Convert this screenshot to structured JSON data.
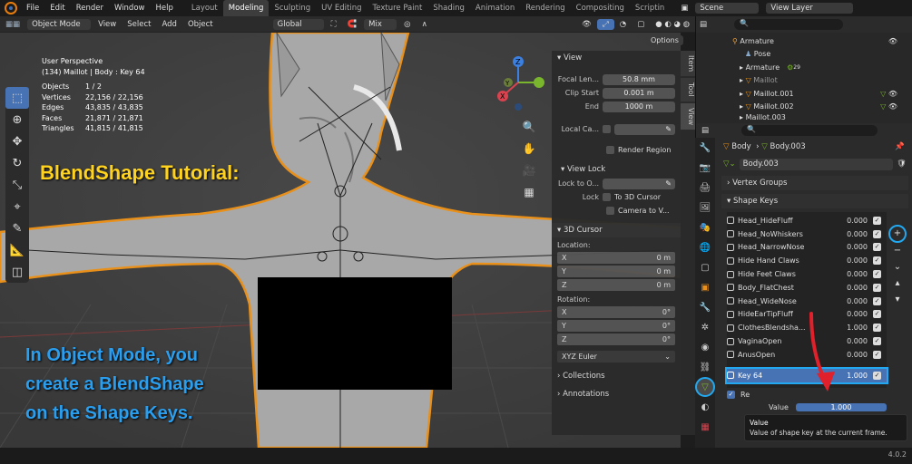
{
  "topbar": {
    "menus": [
      "File",
      "Edit",
      "Render",
      "Window",
      "Help"
    ],
    "workspaces": [
      "Layout",
      "Modeling",
      "Sculpting",
      "UV Editing",
      "Texture Paint",
      "Shading",
      "Animation",
      "Rendering",
      "Compositing",
      "Scriptin"
    ],
    "active_workspace": "Modeling",
    "scene": "Scene",
    "view_layer": "View Layer"
  },
  "viewport_header": {
    "mode": "Object Mode",
    "menus": [
      "View",
      "Select",
      "Add",
      "Object"
    ],
    "orientation": "Global",
    "mix": "Mix",
    "options": "Options"
  },
  "stats": {
    "line1": "User Perspective",
    "line2": "(134) Maillot | Body : Key 64",
    "rows": [
      {
        "k": "Objects",
        "v": "1 / 2"
      },
      {
        "k": "Vertices",
        "v": "22,156 / 22,156"
      },
      {
        "k": "Edges",
        "v": "43,835 / 43,835"
      },
      {
        "k": "Faces",
        "v": "21,871 / 21,871"
      },
      {
        "k": "Triangles",
        "v": "41,815 / 41,815"
      }
    ]
  },
  "annotations": {
    "title": "BlendShape Tutorial:",
    "text_lines": [
      "In Object Mode, you",
      "create a BlendShape",
      "on the Shape Keys."
    ]
  },
  "npanel": {
    "view_header": "View",
    "focal_label": "Focal Len...",
    "focal_value": "50.8 mm",
    "clip_start_label": "Clip Start",
    "clip_start_value": "0.001 m",
    "end_label": "End",
    "end_value": "1000 m",
    "local_camera": "Local Ca...",
    "render_region": "Render Region",
    "view_lock_header": "View Lock",
    "lock_to_label": "Lock to O...",
    "lock_label": "Lock",
    "to_3d_cursor": "To 3D Cursor",
    "camera_to_view": "Camera to V...",
    "cursor_header": "3D Cursor",
    "location_label": "Location:",
    "rotation_label": "Rotation:",
    "loc": [
      {
        "a": "X",
        "v": "0 m"
      },
      {
        "a": "Y",
        "v": "0 m"
      },
      {
        "a": "Z",
        "v": "0 m"
      }
    ],
    "rot": [
      {
        "a": "X",
        "v": "0°"
      },
      {
        "a": "Y",
        "v": "0°"
      },
      {
        "a": "Z",
        "v": "0°"
      }
    ],
    "rot_mode": "XYZ Euler",
    "collections": "Collections",
    "annotations": "Annotations",
    "tabs": [
      "Item",
      "Tool",
      "View"
    ]
  },
  "outliner": {
    "rows": [
      {
        "label": "Armature",
        "indent": 1
      },
      {
        "label": "Pose",
        "indent": 3
      },
      {
        "label": "Armature",
        "indent": 2
      },
      {
        "label": "Maillot",
        "indent": 2
      },
      {
        "label": "Maillot.001",
        "indent": 2
      },
      {
        "label": "Maillot.002",
        "indent": 2
      },
      {
        "label": "Maillot.003",
        "indent": 2
      }
    ],
    "badge": "29"
  },
  "properties": {
    "breadcrumb_a": "Body",
    "breadcrumb_b": "Body.003",
    "mesh_name": "Body.003",
    "vertex_groups": "Vertex Groups",
    "shape_keys": "Shape Keys",
    "keys": [
      {
        "name": "Head_HideFluff",
        "value": "0.000"
      },
      {
        "name": "Head_NoWhiskers",
        "value": "0.000"
      },
      {
        "name": "Head_NarrowNose",
        "value": "0.000"
      },
      {
        "name": "Hide Hand Claws",
        "value": "0.000"
      },
      {
        "name": "Hide Feet Claws",
        "value": "0.000"
      },
      {
        "name": "Body_FlatChest",
        "value": "0.000"
      },
      {
        "name": "Head_WideNose",
        "value": "0.000"
      },
      {
        "name": "HideEarTipFluff",
        "value": "0.000"
      },
      {
        "name": "ClothesBlendsha...",
        "value": "1.000"
      },
      {
        "name": "VaginaOpen",
        "value": "0.000"
      },
      {
        "name": "AnusOpen",
        "value": "0.000"
      }
    ],
    "active_key": {
      "name": "Key 64",
      "value": "1.000"
    },
    "relative_label": "Re",
    "value_label": "Value",
    "value_field": "1.000"
  },
  "tooltip": {
    "title": "Value",
    "desc": "Value of shape key at the current frame."
  },
  "version": "4.0.2"
}
